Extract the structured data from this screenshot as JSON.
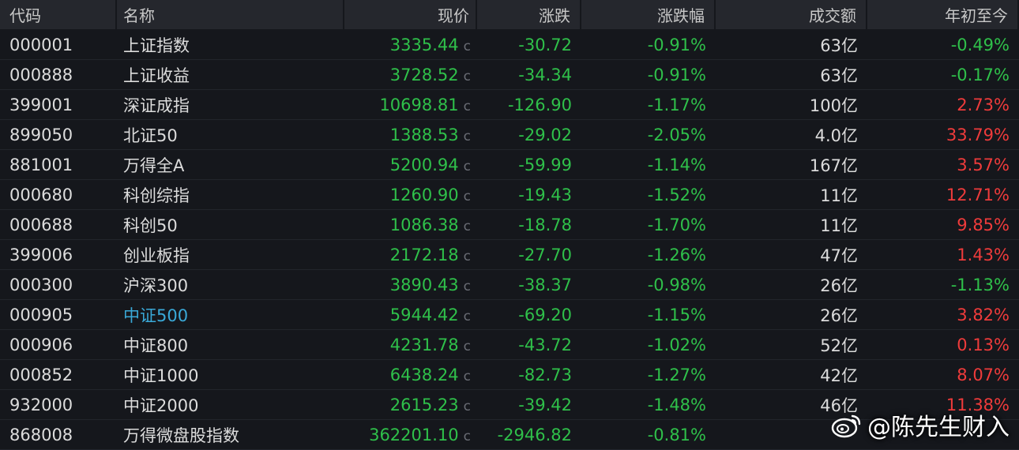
{
  "columns": {
    "code": "代码",
    "name": "名称",
    "price": "现价",
    "change": "涨跌",
    "change_pct": "涨跌幅",
    "volume": "成交额",
    "ytd": "年初至今"
  },
  "price_mark": "c",
  "colors": {
    "up": "#ef3b3b",
    "down": "#2fc04a",
    "link": "#3aa9d8",
    "background": "#15171c",
    "header_bg": "#25272d"
  },
  "rows": [
    {
      "code": "000001",
      "name": "上证指数",
      "price": "3335.44",
      "change": "-30.72",
      "change_pct": "-0.91%",
      "volume": "63亿",
      "ytd": "-0.49%",
      "ytd_dir": "down"
    },
    {
      "code": "000888",
      "name": "上证收益",
      "price": "3728.52",
      "change": "-34.34",
      "change_pct": "-0.91%",
      "volume": "63亿",
      "ytd": "-0.17%",
      "ytd_dir": "down"
    },
    {
      "code": "399001",
      "name": "深证成指",
      "price": "10698.81",
      "change": "-126.90",
      "change_pct": "-1.17%",
      "volume": "100亿",
      "ytd": "2.73%",
      "ytd_dir": "up"
    },
    {
      "code": "899050",
      "name": "北证50",
      "price": "1388.53",
      "change": "-29.02",
      "change_pct": "-2.05%",
      "volume": "4.0亿",
      "ytd": "33.79%",
      "ytd_dir": "up"
    },
    {
      "code": "881001",
      "name": "万得全A",
      "price": "5200.94",
      "change": "-59.99",
      "change_pct": "-1.14%",
      "volume": "167亿",
      "ytd": "3.57%",
      "ytd_dir": "up"
    },
    {
      "code": "000680",
      "name": "科创综指",
      "price": "1260.90",
      "change": "-19.43",
      "change_pct": "-1.52%",
      "volume": "11亿",
      "ytd": "12.71%",
      "ytd_dir": "up"
    },
    {
      "code": "000688",
      "name": "科创50",
      "price": "1086.38",
      "change": "-18.78",
      "change_pct": "-1.70%",
      "volume": "11亿",
      "ytd": "9.85%",
      "ytd_dir": "up"
    },
    {
      "code": "399006",
      "name": "创业板指",
      "price": "2172.18",
      "change": "-27.70",
      "change_pct": "-1.26%",
      "volume": "47亿",
      "ytd": "1.43%",
      "ytd_dir": "up"
    },
    {
      "code": "000300",
      "name": "沪深300",
      "price": "3890.43",
      "change": "-38.37",
      "change_pct": "-0.98%",
      "volume": "26亿",
      "ytd": "-1.13%",
      "ytd_dir": "down"
    },
    {
      "code": "000905",
      "name": "中证500",
      "price": "5944.42",
      "change": "-69.20",
      "change_pct": "-1.15%",
      "volume": "26亿",
      "ytd": "3.82%",
      "ytd_dir": "up",
      "name_link": true
    },
    {
      "code": "000906",
      "name": "中证800",
      "price": "4231.78",
      "change": "-43.72",
      "change_pct": "-1.02%",
      "volume": "52亿",
      "ytd": "0.13%",
      "ytd_dir": "up"
    },
    {
      "code": "000852",
      "name": "中证1000",
      "price": "6438.24",
      "change": "-82.73",
      "change_pct": "-1.27%",
      "volume": "42亿",
      "ytd": "8.07%",
      "ytd_dir": "up"
    },
    {
      "code": "932000",
      "name": "中证2000",
      "price": "2615.23",
      "change": "-39.42",
      "change_pct": "-1.48%",
      "volume": "46亿",
      "ytd": "11.38%",
      "ytd_dir": "up"
    },
    {
      "code": "868008",
      "name": "万得微盘股指数",
      "price": "362201.10",
      "change": "-2946.82",
      "change_pct": "-0.81%",
      "volume": "",
      "ytd": "",
      "ytd_dir": "up"
    }
  ],
  "watermark": {
    "icon": "weibo-icon",
    "text": "@陈先生财入"
  }
}
